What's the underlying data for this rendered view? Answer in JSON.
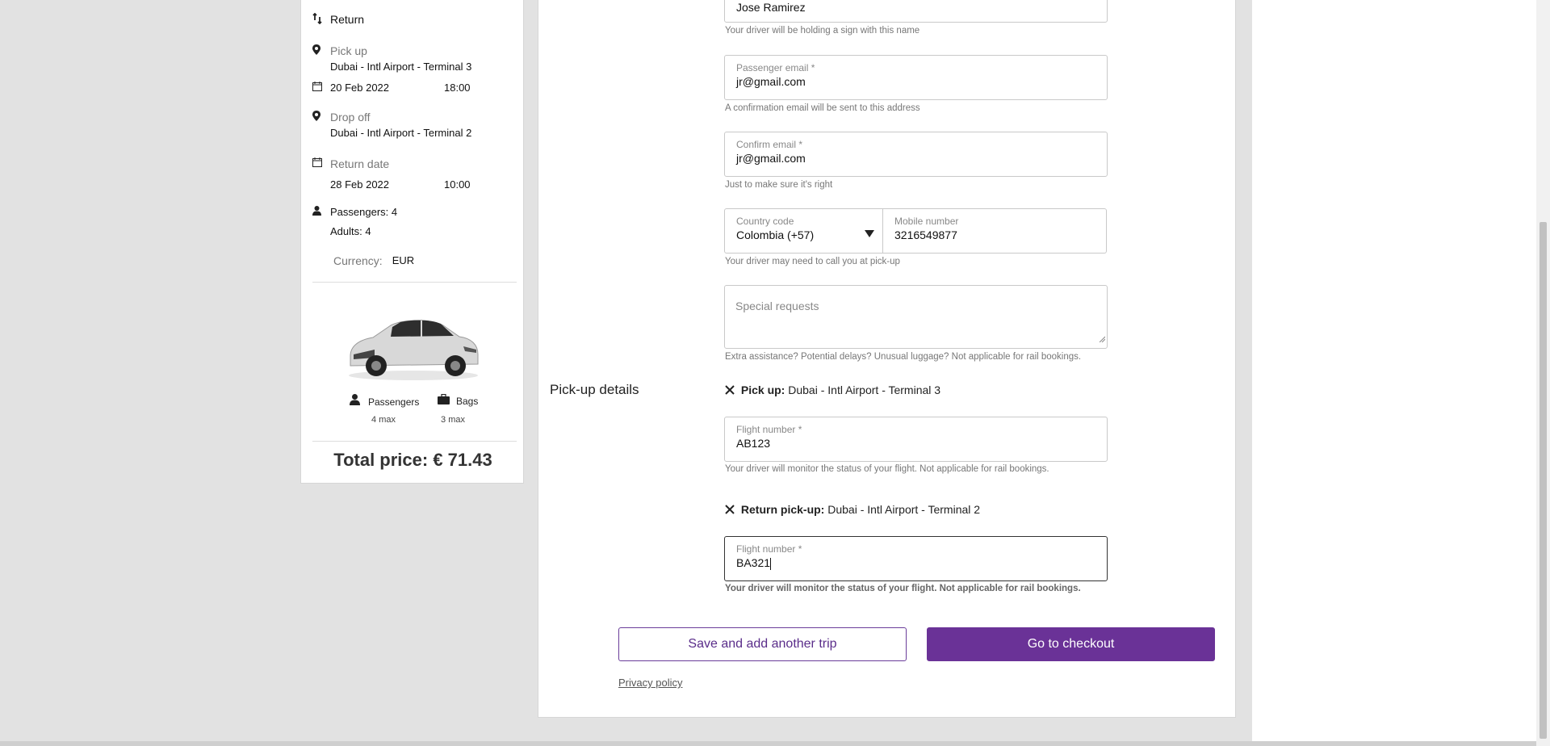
{
  "summary": {
    "trip_type": "Return",
    "pickup_label": "Pick up",
    "pickup_location": "Dubai - Intl Airport - Terminal 3",
    "pickup_date": "20 Feb 2022",
    "pickup_time": "18:00",
    "dropoff_label": "Drop off",
    "dropoff_location": "Dubai - Intl Airport - Terminal 2",
    "return_label": "Return date",
    "return_date": "28 Feb 2022",
    "return_time": "10:00",
    "passengers": "Passengers: 4",
    "adults": "Adults: 4",
    "currency_label": "Currency:",
    "currency_value": "EUR",
    "vehicle": {
      "passengers_label": "Passengers",
      "passengers_max": "4 max",
      "bags_label": "Bags",
      "bags_max": "3 max"
    },
    "total_price": "Total price: € 71.43"
  },
  "form": {
    "name_value": "Jose Ramirez",
    "name_help": "Your driver will be holding a sign with this name",
    "email_label": "Passenger email *",
    "email_value": "jr@gmail.com",
    "email_help": "A confirmation email will be sent to this address",
    "confirm_label": "Confirm email *",
    "confirm_value": "jr@gmail.com",
    "confirm_help": "Just to make sure it's right",
    "country_label": "Country code",
    "country_value": "Colombia (+57)",
    "mobile_label": "Mobile number",
    "mobile_value": "3216549877",
    "mobile_help": "Your driver may need to call you at pick-up",
    "special_placeholder": "Special requests",
    "special_help": "Extra assistance? Potential delays? Unusual luggage? Not applicable for rail bookings."
  },
  "pickup_details": {
    "title": "Pick-up details",
    "pickup_prefix": "Pick up:",
    "pickup_location": "Dubai - Intl Airport - Terminal 3",
    "flight_label": "Flight number *",
    "flight_value": "AB123",
    "flight_help": "Your driver will monitor the status of your flight. Not applicable for rail bookings.",
    "return_prefix": "Return pick-up:",
    "return_location": "Dubai - Intl Airport - Terminal 2",
    "return_flight_label": "Flight number *",
    "return_flight_value": "BA321",
    "return_flight_help": "Your driver will monitor the status of your flight. Not applicable for rail bookings."
  },
  "actions": {
    "save_another": "Save and add another trip",
    "checkout": "Go to checkout",
    "privacy": "Privacy policy"
  },
  "colors": {
    "accent": "#6a3297",
    "background": "#e2e2e2"
  }
}
